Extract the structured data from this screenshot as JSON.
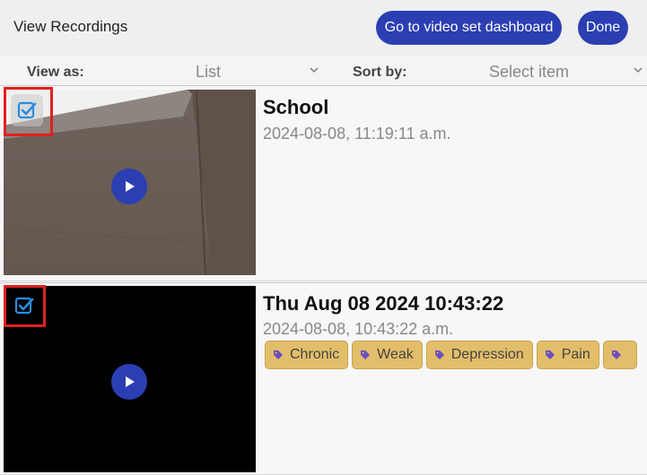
{
  "header": {
    "title": "View Recordings",
    "dashboard_button": "Go to video set dashboard",
    "done_button": "Done"
  },
  "toolbar": {
    "view_as_label": "View as:",
    "view_as_value": "List",
    "sort_by_label": "Sort by:",
    "sort_by_value": "Select item"
  },
  "recordings": [
    {
      "title": "School",
      "date": "2024-08-08, 11:19:11 a.m.",
      "selected": true,
      "tags": []
    },
    {
      "title": "Thu Aug 08 2024 10:43:22",
      "date": "2024-08-08, 10:43:22 a.m.",
      "selected": true,
      "tags": [
        "Chronic",
        "Weak",
        "Depression",
        "Pain",
        ""
      ]
    }
  ],
  "colors": {
    "accent": "#2b3fb3",
    "tag_bg": "#e3be6a",
    "tag_icon": "#6a4fc0",
    "checkbox": "#2a8de0",
    "highlight": "#e0201e"
  },
  "icons": {
    "chevron": "chevron-down-icon",
    "play": "play-icon",
    "checkbox": "checkbox-checked-icon",
    "tag": "tag-icon"
  }
}
